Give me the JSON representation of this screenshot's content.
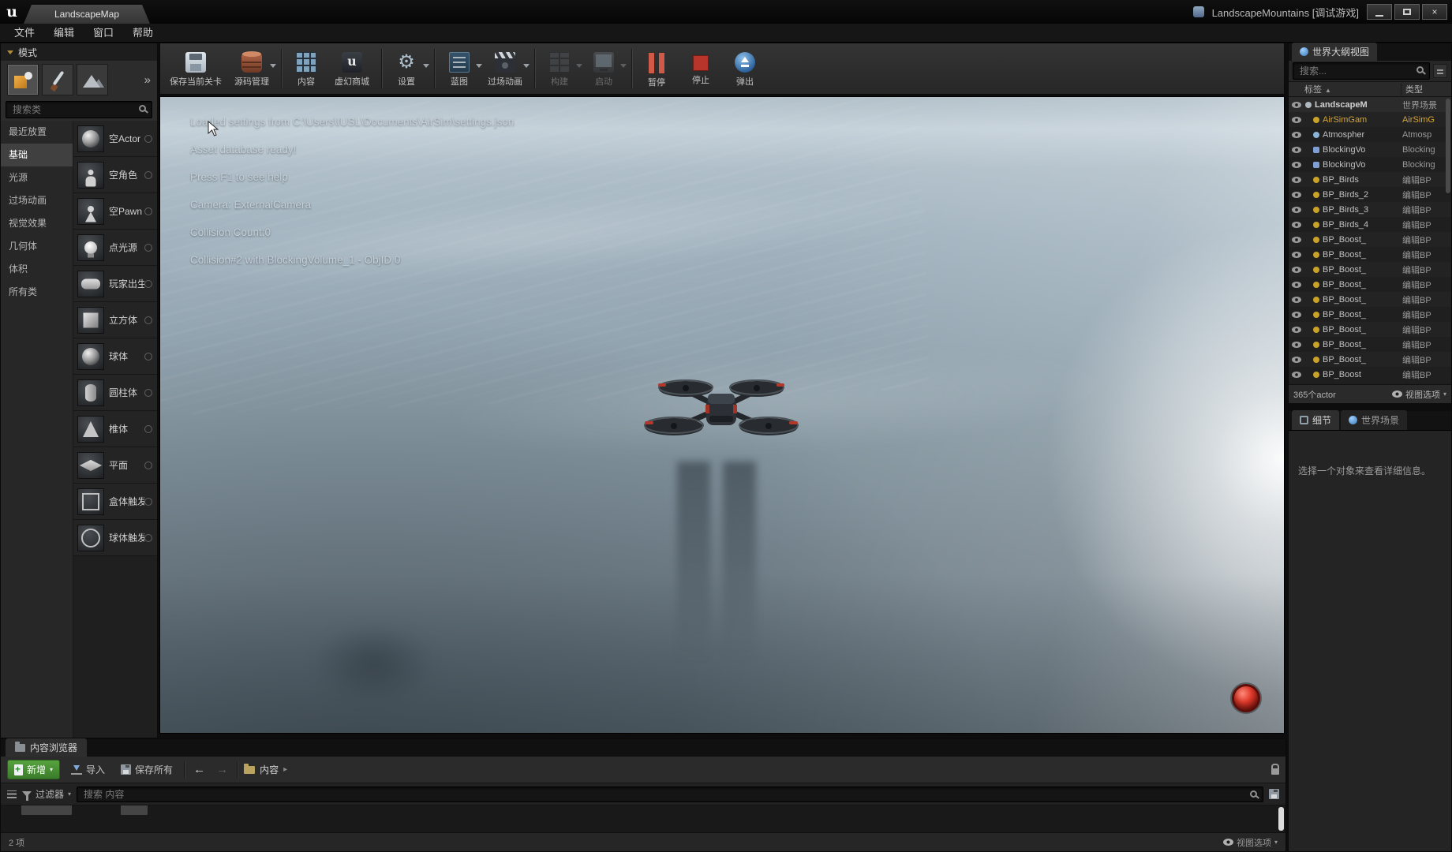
{
  "window": {
    "logo": "u",
    "tab": "LandscapeMap",
    "title": "LandscapeMountains [调试游戏]",
    "close": "×"
  },
  "menu": {
    "items": [
      "文件",
      "编辑",
      "窗口",
      "帮助"
    ]
  },
  "toolbar": {
    "save": "保存当前关卡",
    "source": "源码管理",
    "content": "内容",
    "marketplace": "虚幻商城",
    "settings": "设置",
    "blueprints": "蓝图",
    "cinematics": "过场动画",
    "build": "构建",
    "launch": "启动",
    "pause": "暂停",
    "stop": "停止",
    "eject": "弹出"
  },
  "modes": {
    "header": "模式",
    "more": "»",
    "search_placeholder": "搜索类",
    "categories": [
      {
        "label": "最近放置",
        "cls": ""
      },
      {
        "label": "基础",
        "cls": "selected"
      },
      {
        "label": "光源",
        "cls": ""
      },
      {
        "label": "过场动画",
        "cls": ""
      },
      {
        "label": "视觉效果",
        "cls": ""
      },
      {
        "label": "几何体",
        "cls": ""
      },
      {
        "label": "体积",
        "cls": ""
      },
      {
        "label": "所有类",
        "cls": ""
      }
    ],
    "items": [
      {
        "label": "空Actor",
        "shape": "sphere"
      },
      {
        "label": "空角色",
        "shape": "figure"
      },
      {
        "label": "空Pawn",
        "shape": "pawn"
      },
      {
        "label": "点光源",
        "shape": "bulb"
      },
      {
        "label": "玩家出生点",
        "shape": "gamepad"
      },
      {
        "label": "立方体",
        "shape": "cube"
      },
      {
        "label": "球体",
        "shape": "sphere"
      },
      {
        "label": "圆柱体",
        "shape": "cylinder"
      },
      {
        "label": "椎体",
        "shape": "cone"
      },
      {
        "label": "平面",
        "shape": "plane"
      },
      {
        "label": "盒体触发器",
        "shape": "box"
      },
      {
        "label": "球体触发器",
        "shape": "sphere-wire"
      }
    ]
  },
  "viewport": {
    "log_lines": [
      "Loaded settings from C:\\Users\\IUSL\\Documents\\AirSim\\settings.json",
      "Asset database ready!",
      "Press F1 to see help",
      "Camera: ExternalCamera",
      "Collision Count:0",
      "Collision#2 with BlockingVolume_1 - ObjID 0"
    ]
  },
  "outliner": {
    "tab": "世界大纲视图",
    "search_placeholder": "搜索...",
    "col_label": "标签",
    "col_type": "类型",
    "sort_arrow": "▲",
    "rows": [
      {
        "label": "LandscapeM",
        "type": "世界场景",
        "cls": "root",
        "icls": "ic-world"
      },
      {
        "label": "AirSimGam",
        "type": "AirSimG",
        "cls": "gold",
        "icls": "ic-gold"
      },
      {
        "label": "Atmospher",
        "type": "Atmosp",
        "cls": "",
        "icls": "ic-blue"
      },
      {
        "label": "BlockingVo",
        "type": "Blocking",
        "cls": "",
        "icls": "ic-bluecube"
      },
      {
        "label": "BlockingVo",
        "type": "Blocking",
        "cls": "",
        "icls": "ic-bluecube"
      },
      {
        "label": "BP_Birds",
        "type": "编辑BP",
        "cls": "",
        "icls": "ic-gold"
      },
      {
        "label": "BP_Birds_2",
        "type": "编辑BP",
        "cls": "",
        "icls": "ic-gold"
      },
      {
        "label": "BP_Birds_3",
        "type": "编辑BP",
        "cls": "",
        "icls": "ic-gold"
      },
      {
        "label": "BP_Birds_4",
        "type": "编辑BP",
        "cls": "",
        "icls": "ic-gold"
      },
      {
        "label": "BP_Boost_",
        "type": "编辑BP",
        "cls": "",
        "icls": "ic-gold"
      },
      {
        "label": "BP_Boost_",
        "type": "编辑BP",
        "cls": "",
        "icls": "ic-gold"
      },
      {
        "label": "BP_Boost_",
        "type": "编辑BP",
        "cls": "",
        "icls": "ic-gold"
      },
      {
        "label": "BP_Boost_",
        "type": "编辑BP",
        "cls": "",
        "icls": "ic-gold"
      },
      {
        "label": "BP_Boost_",
        "type": "编辑BP",
        "cls": "",
        "icls": "ic-gold"
      },
      {
        "label": "BP_Boost_",
        "type": "编辑BP",
        "cls": "",
        "icls": "ic-gold"
      },
      {
        "label": "BP_Boost_",
        "type": "编辑BP",
        "cls": "",
        "icls": "ic-gold"
      },
      {
        "label": "BP_Boost_",
        "type": "编辑BP",
        "cls": "",
        "icls": "ic-gold"
      },
      {
        "label": "BP_Boost_",
        "type": "编辑BP",
        "cls": "",
        "icls": "ic-gold"
      },
      {
        "label": "BP_Boost",
        "type": "编辑BP",
        "cls": "",
        "icls": "ic-gold"
      }
    ],
    "footer_count": "365个actor",
    "view_options": "视图选项"
  },
  "details": {
    "tab_details": "细节",
    "tab_world": "世界场景",
    "hint": "选择一个对象来查看详细信息。"
  },
  "content_browser": {
    "tab": "内容浏览器",
    "add_new": "新增",
    "import": "导入",
    "save_all": "保存所有",
    "breadcrumb": "内容",
    "filters": "过滤器",
    "search_placeholder": "搜索 内容",
    "status_count": "2 项",
    "view_options": "视图选项"
  }
}
